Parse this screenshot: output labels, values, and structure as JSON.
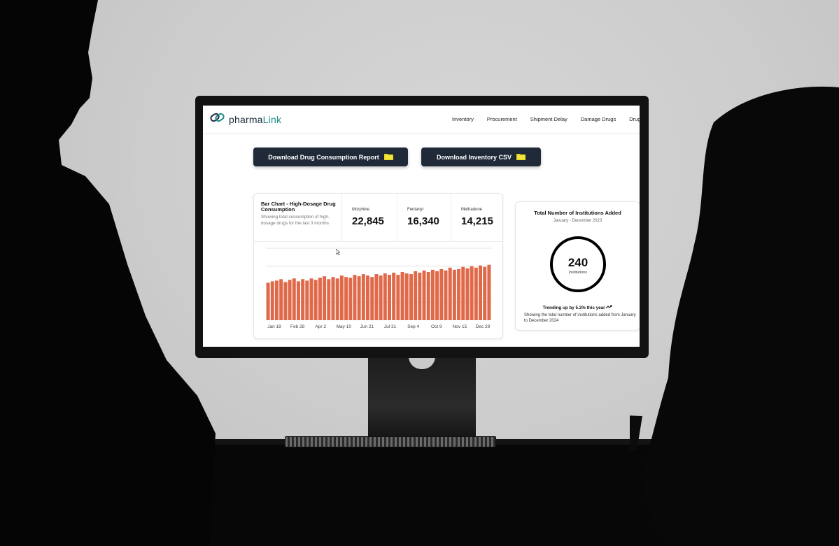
{
  "brand": {
    "name_part1": "pharma",
    "name_part2": "Link",
    "accent_color": "#1f8a8a"
  },
  "nav": {
    "items": [
      "Inventory",
      "Procurement",
      "Shipment Delay",
      "Damage Drugs",
      "Drug"
    ]
  },
  "actions": {
    "download_report_label": "Download Drug Consumption Report",
    "download_inventory_label": "Download Inventory CSV",
    "button_icon": "folder-icon",
    "button_icon_color": "#e5d31a"
  },
  "consumption_card": {
    "title": "Bar Chart - High-Dosage Drug Consumption",
    "subtitle": "Showing total consumption of high-dosage drugs for the last 3 months",
    "stats": [
      {
        "label": "Morphine",
        "value": "22,845"
      },
      {
        "label": "Fentanyl",
        "value": "16,340"
      },
      {
        "label": "Methadone",
        "value": "14,215"
      }
    ]
  },
  "chart_data": {
    "type": "bar",
    "bar_color": "#e0694a",
    "grid": true,
    "x_tick_labels": [
      "Jan 18",
      "Feb 28",
      "Apr 2",
      "May 10",
      "Jun 21",
      "Jul 31",
      "Sep 4",
      "Oct 9",
      "Nov 15",
      "Dec 29"
    ],
    "values": [
      52,
      54,
      55,
      57,
      53,
      56,
      58,
      54,
      57,
      55,
      58,
      56,
      59,
      61,
      57,
      60,
      58,
      62,
      60,
      59,
      63,
      61,
      64,
      62,
      60,
      64,
      62,
      65,
      63,
      66,
      63,
      67,
      65,
      64,
      68,
      66,
      69,
      67,
      70,
      68,
      71,
      69,
      73,
      70,
      71,
      74,
      72,
      75,
      73,
      76,
      74,
      77
    ],
    "ylim": [
      0,
      100
    ]
  },
  "institutions_card": {
    "title": "Total Number of Institutions Added",
    "period": "January - December 2023",
    "value": "240",
    "value_label": "institutions",
    "trend": "Trending up by 5.2% this year",
    "trend_icon": "trending-up-icon",
    "description": "Showing the total number of institutions added from January to December 2024"
  }
}
